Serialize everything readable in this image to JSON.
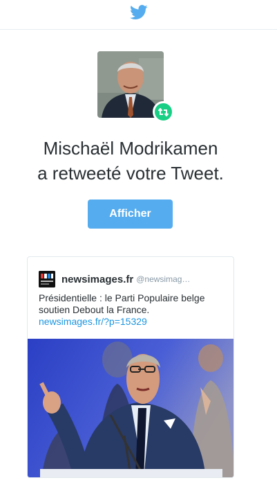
{
  "header": {
    "logo_icon": "twitter-bird-icon",
    "brand_color": "#55acee"
  },
  "notification": {
    "retweeter_name": "Mischaël Modrikamen",
    "action_text": "a retweeté votre Tweet.",
    "badge_icon": "retweet-icon",
    "badge_color": "#19cf86"
  },
  "cta": {
    "label": "Afficher"
  },
  "tweet": {
    "author_name": "newsimages.fr",
    "author_handle": "@newsimag…",
    "text": "Présidentielle : le Parti Populaire belge soutien Debout la France.",
    "link": "newsimages.fr/?p=15329"
  }
}
